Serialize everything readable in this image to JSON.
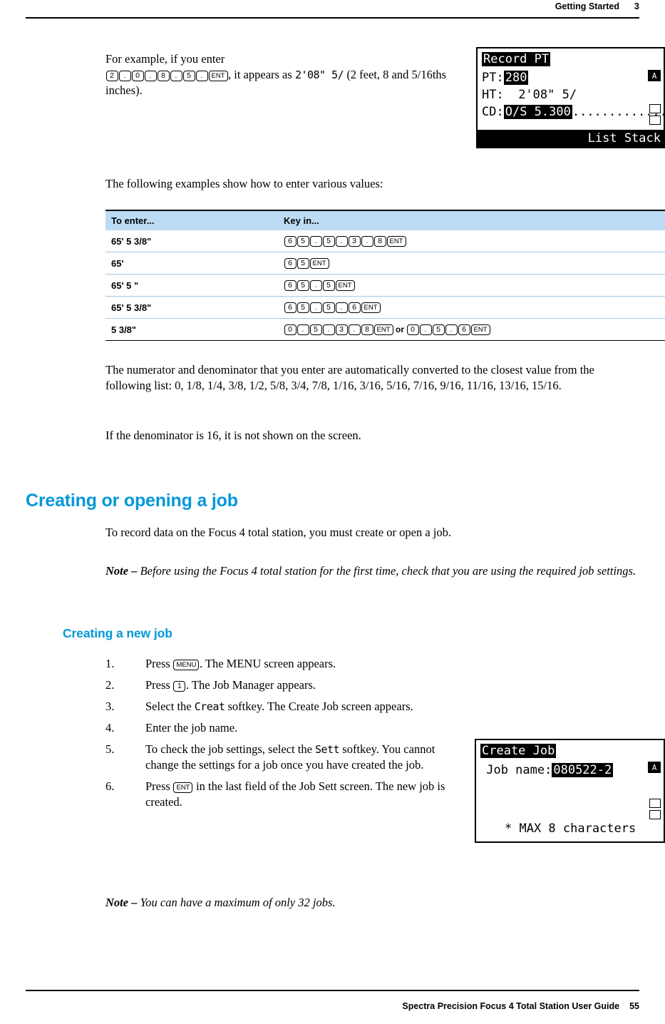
{
  "header": {
    "title": "Getting Started",
    "page_number": "3"
  },
  "footer": {
    "guide": "Spectra Precision Focus 4 Total Station User Guide",
    "page": "55"
  },
  "intro": {
    "line1": "For example, if you enter",
    "keys": [
      "2",
      ".",
      "0",
      ".",
      "8",
      ".",
      "5",
      ".",
      "ENT"
    ],
    "after_keys": ", it appears as",
    "lcd_value": "2'08\"  5/",
    "tail": "(2 feet, 8 and 5/16ths inches).",
    "following": "The following examples show how to enter various values:"
  },
  "table": {
    "headers": [
      "To enter...",
      "Key in..."
    ],
    "rows": [
      {
        "enter": "65' 5 3/8\"",
        "keys": [
          "6",
          "5",
          ".",
          "5",
          ".",
          "3",
          ".",
          "8",
          "ENT"
        ],
        "alt_keys": null,
        "or": null
      },
      {
        "enter": "65'",
        "keys": [
          "6",
          "5",
          "ENT"
        ],
        "alt_keys": null,
        "or": null
      },
      {
        "enter": "65' 5 \"",
        "keys": [
          "6",
          "5",
          ".",
          "5",
          "ENT"
        ],
        "alt_keys": null,
        "or": null
      },
      {
        "enter": "65' 5 3/8\"",
        "keys": [
          "6",
          "5",
          ".",
          "5",
          ".",
          "6",
          "ENT"
        ],
        "alt_keys": null,
        "or": null
      },
      {
        "enter": "5 3/8\"",
        "keys": [
          "0",
          ".",
          "5",
          ".",
          "3",
          ".",
          "8",
          "ENT"
        ],
        "or": "or",
        "alt_keys": [
          "0",
          ".",
          "5",
          ".",
          "6",
          "ENT"
        ]
      }
    ]
  },
  "paragraphs": {
    "numerator": "The numerator and denominator that you enter are automatically converted to the closest value from the following list: 0, 1/8, 1/4, 3/8, 1/2, 5/8, 3/4, 7/8, 1/16, 3/16, 5/16, 7/16, 9/16, 11/16, 13/16, 15/16.",
    "denominator": "If the denominator is 16, it is not shown on the screen."
  },
  "section": {
    "heading": "Creating or opening a job",
    "body": "To record data on the Focus 4 total station, you must create or open a job.",
    "note_label": "Note –",
    "note_text": "Before using the Focus 4 total station for the first time, check that you are using the required job settings.",
    "subheading": "Creating a new job"
  },
  "steps": [
    {
      "num": "1.",
      "pre": "Press",
      "key": "MENU",
      "post": ". The MENU screen appears."
    },
    {
      "num": "2.",
      "pre": "Press",
      "key": "1",
      "post": ". The Job Manager appears."
    },
    {
      "num": "3.",
      "pre": "Select the",
      "lcd": "Creat",
      "post": "softkey. The Create Job screen appears."
    },
    {
      "num": "4.",
      "pre": "Enter the job name.",
      "key": null,
      "post": ""
    },
    {
      "num": "5.",
      "pre": "To check the job settings, select the",
      "lcd": "Sett",
      "post": "softkey. You cannot change the settings for a job once you have created the job."
    },
    {
      "num": "6.",
      "pre": "Press",
      "key": "ENT",
      "post": "in the last field of the Job Sett screen. The new job is created."
    }
  ],
  "final_note": {
    "label": "Note –",
    "text": "You can have a maximum of only 32 jobs."
  },
  "lcd_record": {
    "title": "Record PT",
    "rows": [
      {
        "label": "PT:",
        "value": "280",
        "highlight": true
      },
      {
        "label": "HT:",
        "value": "  2'08\" 5/",
        "highlight": false
      },
      {
        "label": "CD:",
        "value": "O/S 5.300",
        "highlight": true
      }
    ],
    "dots": "..............",
    "side_marker": "A",
    "bottom_bar": "List Stack"
  },
  "lcd_createjob": {
    "title": "Create Job",
    "field_label": " Job name:",
    "field_value": "080522-2",
    "hint": "* MAX 8 characters",
    "side_marker": "A"
  },
  "colors": {
    "heading_blue": "#0098d8",
    "table_header_bg": "#bcdcf5",
    "rule": "#000000"
  }
}
